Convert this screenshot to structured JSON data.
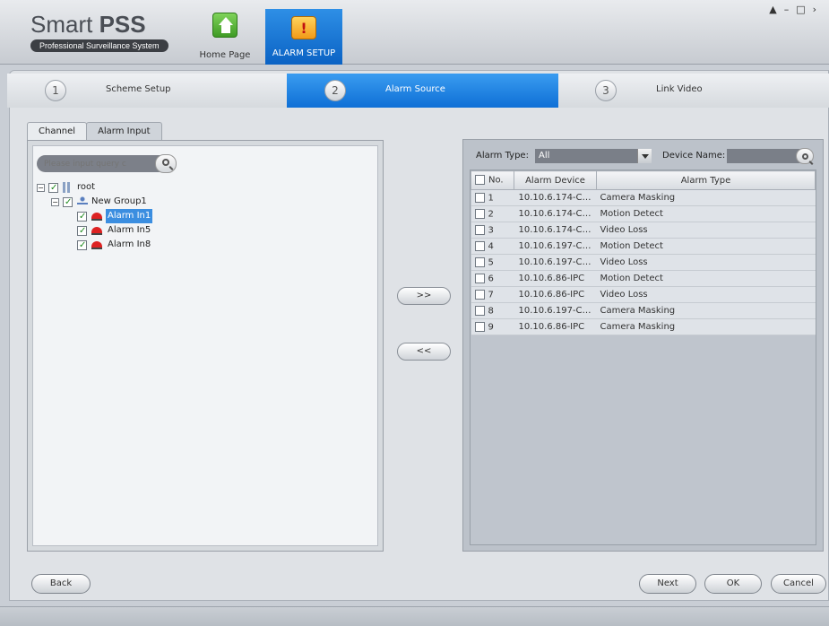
{
  "app": {
    "title_light": "Smart ",
    "title_bold": "PSS",
    "subtitle": "Professional Surveillance System"
  },
  "nav": {
    "home_label": "Home Page",
    "alarm_setup_label": "ALARM SETUP"
  },
  "window_controls": [
    "lock-icon",
    "minimize-icon",
    "maximize-icon",
    "close-icon"
  ],
  "steps": [
    {
      "num": "1",
      "label": "Scheme Setup",
      "active": false
    },
    {
      "num": "2",
      "label": "Alarm Source",
      "active": true
    },
    {
      "num": "3",
      "label": "Link Video",
      "active": false
    }
  ],
  "tabs": [
    {
      "label": "Channel",
      "active": false
    },
    {
      "label": "Alarm Input",
      "active": true
    }
  ],
  "search": {
    "placeholder": "Please input query c"
  },
  "tree": {
    "root": "root",
    "group": "New Group1",
    "alarms": [
      "Alarm In1",
      "Alarm In5",
      "Alarm In8"
    ]
  },
  "move": {
    "add": ">>",
    "remove": "<<"
  },
  "filter": {
    "alarm_type_label": "Alarm Type:",
    "alarm_type_value": "All",
    "device_name_label": "Device Name:"
  },
  "table": {
    "headers": [
      "No.",
      "Alarm Device",
      "Alarm Type"
    ],
    "rows": [
      {
        "no": "1",
        "device": "10.10.6.174-CA...",
        "type": "Camera Masking"
      },
      {
        "no": "2",
        "device": "10.10.6.174-CA...",
        "type": "Motion Detect"
      },
      {
        "no": "3",
        "device": "10.10.6.174-CA...",
        "type": "Video Loss"
      },
      {
        "no": "4",
        "device": "10.10.6.197-CA...",
        "type": "Motion Detect"
      },
      {
        "no": "5",
        "device": "10.10.6.197-CA...",
        "type": "Video Loss"
      },
      {
        "no": "6",
        "device": "10.10.6.86-IPC",
        "type": "Motion Detect"
      },
      {
        "no": "7",
        "device": "10.10.6.86-IPC",
        "type": "Video Loss"
      },
      {
        "no": "8",
        "device": "10.10.6.197-CA...",
        "type": "Camera Masking"
      },
      {
        "no": "9",
        "device": "10.10.6.86-IPC",
        "type": "Camera Masking"
      }
    ]
  },
  "buttons": {
    "back": "Back",
    "next": "Next",
    "ok": "OK",
    "cancel": "Cancel"
  },
  "colors": {
    "accent": "#0e6fd6",
    "selection": "#3b8ee0"
  }
}
